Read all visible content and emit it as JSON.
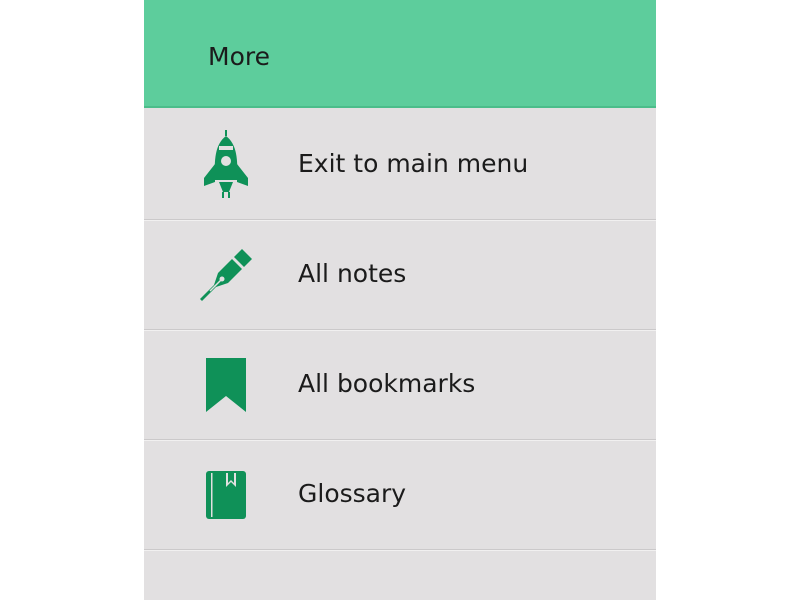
{
  "header": {
    "title": "More"
  },
  "menu": {
    "items": [
      {
        "label": "Exit to main menu",
        "icon": "rocket-icon"
      },
      {
        "label": "All notes",
        "icon": "fountain-pen-icon"
      },
      {
        "label": "All bookmarks",
        "icon": "bookmark-icon"
      },
      {
        "label": "Glossary",
        "icon": "book-icon"
      }
    ]
  },
  "colors": {
    "header_bg": "#5dcd9c",
    "panel_bg": "#e2e0e1",
    "icon": "#0f9158",
    "text": "#1b1b1b"
  }
}
